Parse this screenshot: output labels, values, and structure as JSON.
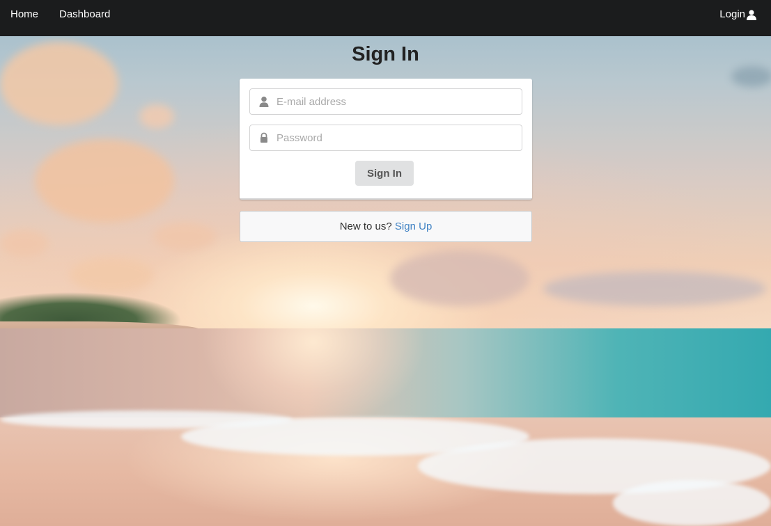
{
  "nav": {
    "home": "Home",
    "dashboard": "Dashboard",
    "login": "Login",
    "login_icon": "user-icon"
  },
  "page": {
    "title": "Sign In"
  },
  "form": {
    "email_placeholder": "E-mail address",
    "email_value": "",
    "email_icon": "user-icon",
    "password_placeholder": "Password",
    "password_value": "",
    "password_icon": "lock-icon",
    "submit_label": "Sign In"
  },
  "signup": {
    "prompt": "New to us?",
    "link_label": "Sign Up"
  },
  "colors": {
    "navbar": "#1b1c1d",
    "link": "#4183c4",
    "button": "#e0e1e2"
  }
}
